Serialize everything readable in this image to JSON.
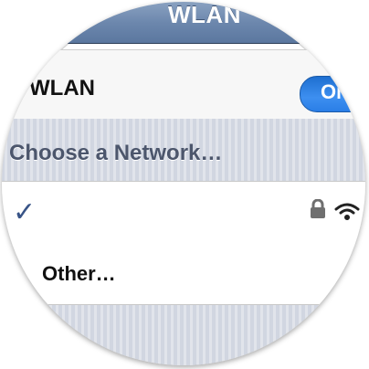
{
  "navbar": {
    "title": "WLAN"
  },
  "wlan": {
    "label": "WLAN",
    "toggle_label": "ON"
  },
  "networks": {
    "section_header": "Choose a Network…",
    "selected_row": {
      "check": "✓",
      "icons": [
        "lock-icon",
        "wifi-icon"
      ]
    },
    "other_label": "Other…"
  },
  "colors": {
    "navbar": "#6c87ad",
    "toggle": "#2a7ee6",
    "section_bg": "#d1d6e1",
    "header_text": "#4c566c",
    "check": "#385487"
  }
}
